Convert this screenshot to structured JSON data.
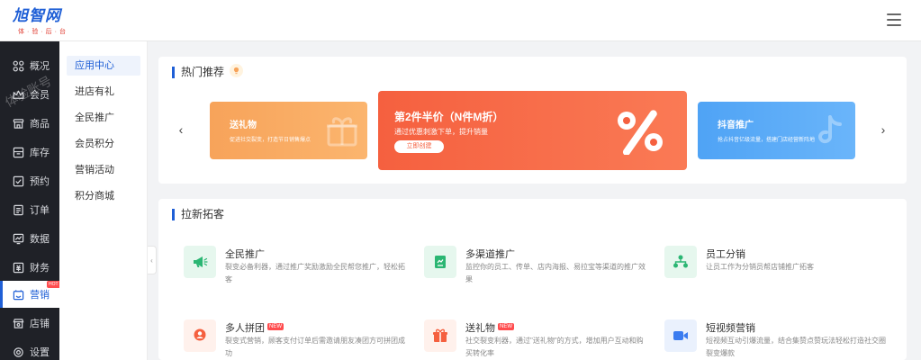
{
  "header": {
    "logo_text": "旭智网",
    "logo_subtext": "体·验·后·台"
  },
  "nav": {
    "watermark": "体验账号",
    "hot_label": "HOT",
    "items": [
      {
        "label": "概况",
        "icon": "dashboard-icon"
      },
      {
        "label": "会员",
        "icon": "crown-icon"
      },
      {
        "label": "商品",
        "icon": "store-icon"
      },
      {
        "label": "库存",
        "icon": "inventory-icon"
      },
      {
        "label": "预约",
        "icon": "checkbox-icon"
      },
      {
        "label": "订单",
        "icon": "order-icon"
      },
      {
        "label": "数据",
        "icon": "chart-icon"
      },
      {
        "label": "财务",
        "icon": "finance-icon"
      },
      {
        "label": "营销",
        "icon": "marketing-icon"
      },
      {
        "label": "店铺",
        "icon": "shop-icon"
      },
      {
        "label": "设置",
        "icon": "settings-icon"
      }
    ]
  },
  "subnav": {
    "items": [
      "应用中心",
      "进店有礼",
      "全民推广",
      "会员积分",
      "营销活动",
      "积分商城"
    ]
  },
  "hot": {
    "title": "热门推荐",
    "banners": [
      {
        "title": "送礼物",
        "desc": "促进社交裂变，打造节日销售爆点"
      },
      {
        "title": "第2件半价（N件M折）",
        "desc": "通过优惠刺激下单，提升销量",
        "button": "立即创建"
      },
      {
        "title": "抖音推广",
        "desc": "抢占抖音亿级流量，搭建门店经营新阵地"
      }
    ]
  },
  "acquire": {
    "title": "拉新拓客",
    "new_label": "NEW",
    "features": [
      {
        "title": "全民推广",
        "desc": "裂变必备利器，通过推广奖励激励全民帮您推广，轻松拓客",
        "icon": "megaphone-icon",
        "new": false
      },
      {
        "title": "多渠道推广",
        "desc": "监控你的员工、传单、店内海报、易拉宝等渠道的推广效果",
        "icon": "channel-icon",
        "new": false
      },
      {
        "title": "员工分销",
        "desc": "让员工作为分销员帮店铺推广拓客",
        "icon": "team-icon",
        "new": false
      },
      {
        "title": "多人拼团",
        "desc": "裂变式营销，顾客支付订单后需邀请朋友凑团方可拼团成功",
        "icon": "group-icon",
        "new": true
      },
      {
        "title": "送礼物",
        "desc": "社交裂变利器，通过\"送礼物\"的方式，增加用户互动和购买转化率",
        "icon": "gift-icon",
        "new": true
      },
      {
        "title": "短视频营销",
        "desc": "短视频互动引爆流量，结合集赞点赞玩法轻松打造社交圈裂变爆款",
        "icon": "video-icon",
        "new": false
      }
    ]
  },
  "colors": {
    "brand": "#1f5fd6",
    "sidebar_bg": "#1f2127",
    "banner_orange": "#f7a35a",
    "banner_red": "#f5603f",
    "banner_blue": "#4fa3f5"
  }
}
